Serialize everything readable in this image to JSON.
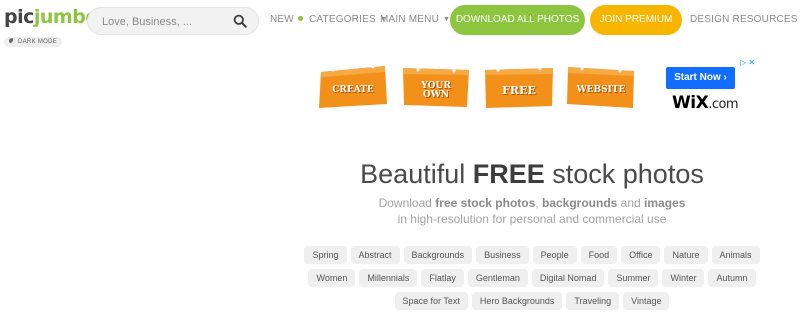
{
  "header": {
    "logo_brand": "pic",
    "logo_rest": "jumbo",
    "search_placeholder": "Love, Business, ...",
    "nav": {
      "new": "NEW",
      "categories": "CATEGORIES",
      "main_menu": "MAIN MENU",
      "download_all": "DOWNLOAD ALL PHOTOS",
      "join_premium": "JOIN PREMIUM",
      "design_resources": "DESIGN RESOURCES"
    },
    "dark_mode_label": "DARK MODE"
  },
  "ad": {
    "words": [
      {
        "l1": "CREATE",
        "l2": ""
      },
      {
        "l1": "YOUR",
        "l2": "OWN"
      },
      {
        "l1": "FREE",
        "l2": ""
      },
      {
        "l1": "WEBSITE",
        "l2": ""
      }
    ],
    "cta_label": "Start Now",
    "cta_arrow": "›",
    "close_label": "▷ ✕",
    "brand_main": "WiX",
    "brand_suffix": ".com"
  },
  "hero": {
    "headline_pre": "Beautiful ",
    "headline_bold": "FREE",
    "headline_post": " stock photos",
    "sub_1": "Download ",
    "sub_bold_1": "free stock photos",
    "sub_2": ", ",
    "sub_bold_2": "backgrounds",
    "sub_3": " and ",
    "sub_bold_3": "images",
    "sub_line2": "in high-resolution for personal and commercial use"
  },
  "tags": {
    "row1": [
      "Spring",
      "Abstract",
      "Backgrounds",
      "Business",
      "People",
      "Food",
      "Office",
      "Nature",
      "Animals"
    ],
    "row2": [
      "Women",
      "Millennials",
      "Flatlay",
      "Gentleman",
      "Digital Nomad",
      "Summer",
      "Winter",
      "Autumn"
    ],
    "row3": [
      "Space for Text",
      "Hero Backgrounds",
      "Traveling",
      "Vintage"
    ]
  },
  "colors": {
    "brand_green": "#8cc63f",
    "premium_yellow": "#f7b500",
    "ad_orange": "#f39019",
    "wix_blue": "#116dff"
  }
}
